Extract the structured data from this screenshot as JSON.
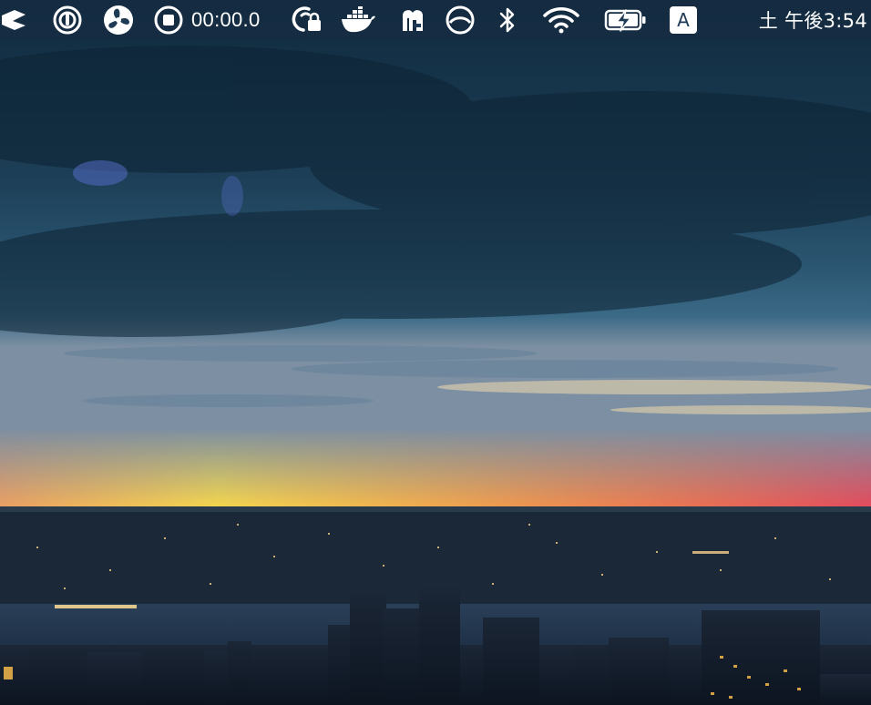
{
  "menubar": {
    "items": [
      {
        "name": "app-icon",
        "label": ""
      },
      {
        "name": "power-icon",
        "label": ""
      },
      {
        "name": "fan-icon",
        "label": ""
      },
      {
        "name": "record-stop-icon",
        "label": "00:00.0"
      },
      {
        "name": "network-lock-icon",
        "label": ""
      },
      {
        "name": "docker-whale-icon",
        "label": ""
      },
      {
        "name": "memory-icon",
        "label": ""
      },
      {
        "name": "speed-gauge-icon",
        "label": ""
      },
      {
        "name": "bluetooth-icon",
        "label": ""
      },
      {
        "name": "wifi-icon",
        "label": ""
      },
      {
        "name": "battery-charging-icon",
        "label": ""
      },
      {
        "name": "input-method-icon",
        "label": "A"
      }
    ],
    "timer_text": "00:00.0",
    "input_method_letter": "A",
    "clock_text": "土 午後3:54"
  },
  "desktop": {
    "wallpaper_subject": "city-skyline-at-sunset",
    "accent_colors": {
      "sky_dark": "#0f2a3e",
      "sky_mid": "#24506b",
      "sunset_yellow": "#f8d54a",
      "sunset_red": "#ee5c4e",
      "water": "#1b2f45"
    }
  }
}
